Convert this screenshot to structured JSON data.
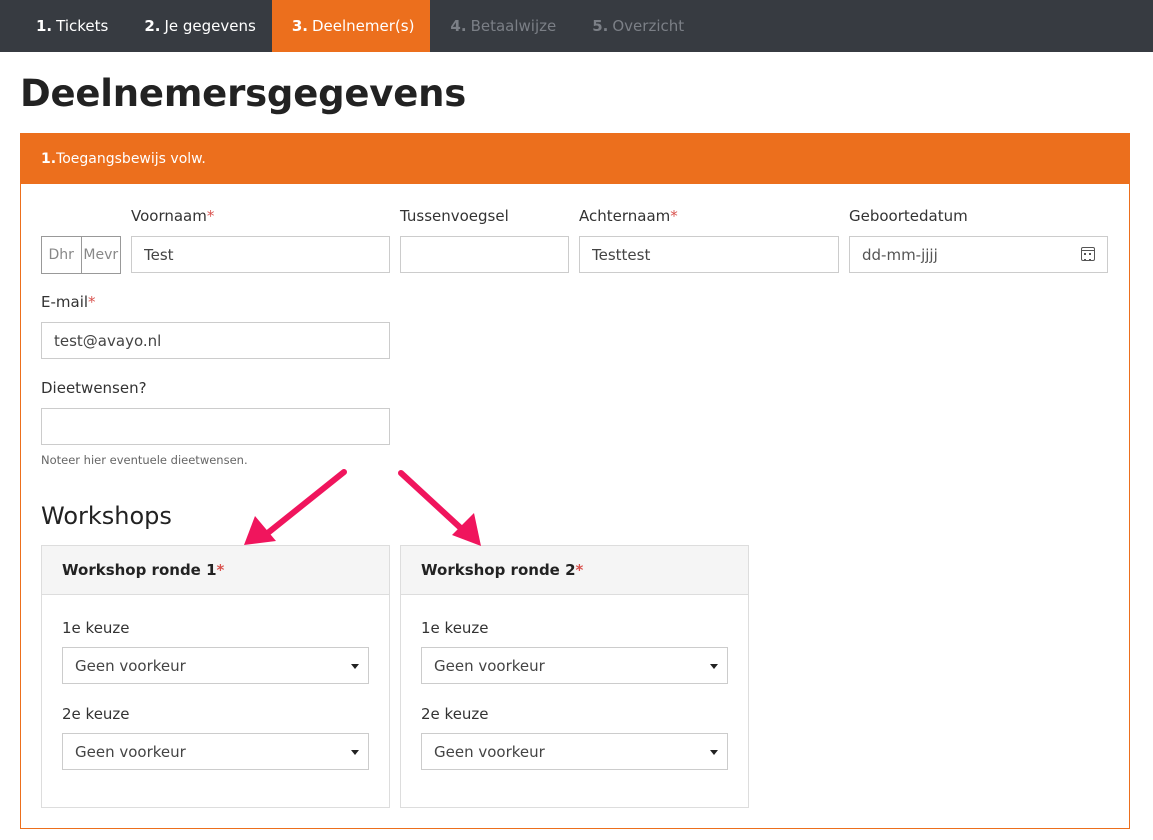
{
  "steps": [
    {
      "num": "1.",
      "label": "Tickets"
    },
    {
      "num": "2.",
      "label": "Je gegevens"
    },
    {
      "num": "3.",
      "label": "Deelnemer(s)"
    },
    {
      "num": "4.",
      "label": "Betaalwijze"
    },
    {
      "num": "5.",
      "label": "Overzicht"
    }
  ],
  "page_title": "Deelnemersgegevens",
  "panel": {
    "num": "1.",
    "title": "Toegangsbewijs volw."
  },
  "form": {
    "gender": {
      "dhr": "Dhr",
      "mevr": "Mevr"
    },
    "voornaam": {
      "label": "Voornaam",
      "value": "Test"
    },
    "tussenvoegsel": {
      "label": "Tussenvoegsel",
      "value": ""
    },
    "achternaam": {
      "label": "Achternaam",
      "value": "Testtest"
    },
    "geboortedatum": {
      "label": "Geboortedatum",
      "placeholder": "dd-mm-jjjj"
    },
    "email": {
      "label": "E-mail",
      "value": "test@avayo.nl"
    },
    "dieet": {
      "label": "Dieetwensen?",
      "value": "",
      "help": "Noteer hier eventuele dieetwensen."
    },
    "required_mark": "*"
  },
  "workshops": {
    "title": "Workshops",
    "rounds": [
      {
        "title": "Workshop ronde 1",
        "choice1_label": "1e keuze",
        "choice1_value": "Geen voorkeur",
        "choice2_label": "2e keuze",
        "choice2_value": "Geen voorkeur"
      },
      {
        "title": "Workshop ronde 2",
        "choice1_label": "1e keuze",
        "choice1_value": "Geen voorkeur",
        "choice2_label": "2e keuze",
        "choice2_value": "Geen voorkeur"
      }
    ]
  },
  "colors": {
    "accent": "#ec6f1d",
    "nav_bg": "#373b41",
    "arrow": "#f0155d",
    "required": "#d9534f"
  }
}
